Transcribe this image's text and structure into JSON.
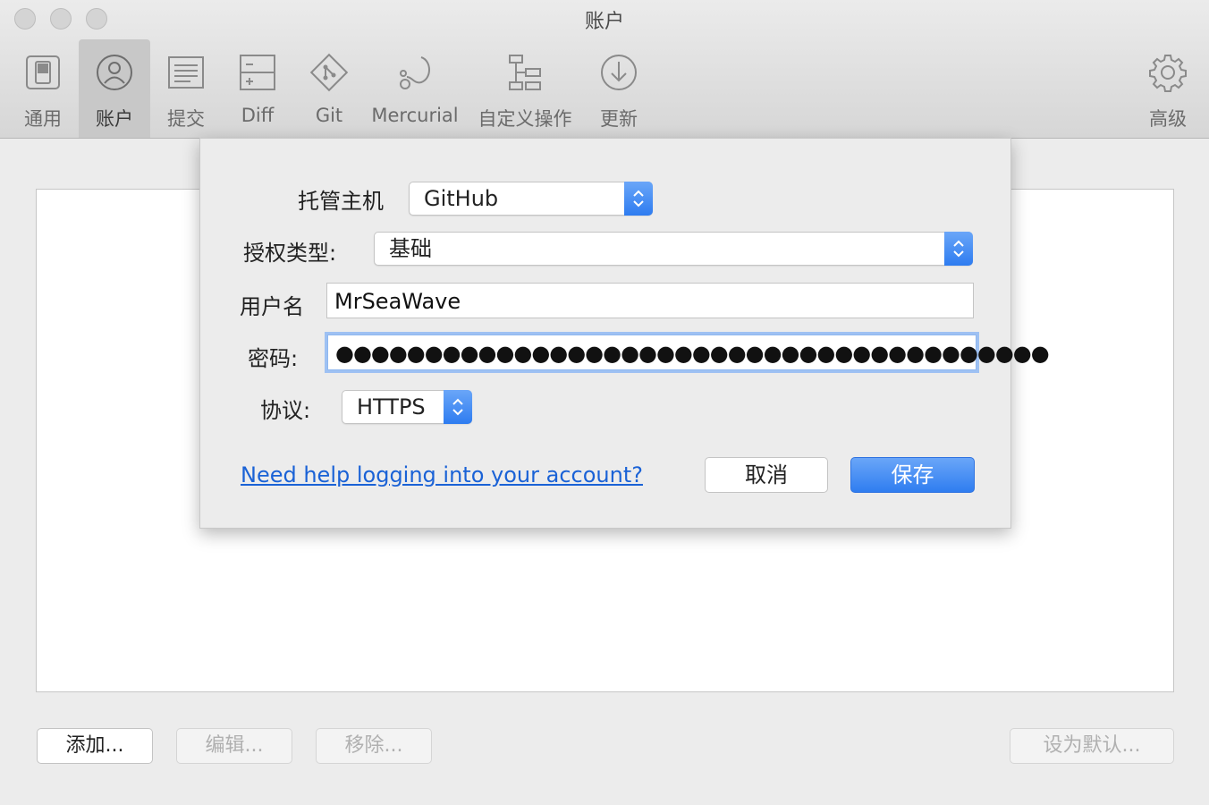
{
  "window": {
    "title": "账户"
  },
  "toolbar": {
    "items": [
      {
        "label": "通用",
        "icon": "switch-icon"
      },
      {
        "label": "账户",
        "icon": "user-icon",
        "selected": true
      },
      {
        "label": "提交",
        "icon": "document-icon"
      },
      {
        "label": "Diff",
        "icon": "diff-icon"
      },
      {
        "label": "Git",
        "icon": "git-icon"
      },
      {
        "label": "Mercurial",
        "icon": "mercurial-icon"
      },
      {
        "label": "自定义操作",
        "icon": "custom-actions-icon"
      },
      {
        "label": "更新",
        "icon": "download-icon"
      }
    ],
    "advanced": {
      "label": "高级",
      "icon": "gear-icon"
    }
  },
  "dialog": {
    "host_label": "托管主机",
    "host_value": "GitHub",
    "auth_label": "授权类型:",
    "auth_value": "基础",
    "username_label": "用户名",
    "username_value": "MrSeaWave",
    "password_label": "密码:",
    "password_value": "●●●●●●●●●●●●●●●●●●●●●●●●●●●●●●●●●●●●●●●●",
    "protocol_label": "协议:",
    "protocol_value": "HTTPS",
    "help_link": "Need help logging into your account?",
    "cancel_label": "取消",
    "save_label": "保存"
  },
  "bottom_buttons": {
    "add": "添加...",
    "edit": "编辑...",
    "remove": "移除...",
    "set_default": "设为默认..."
  },
  "colors": {
    "accent": "#2f7df0",
    "link": "#1a62d6"
  }
}
